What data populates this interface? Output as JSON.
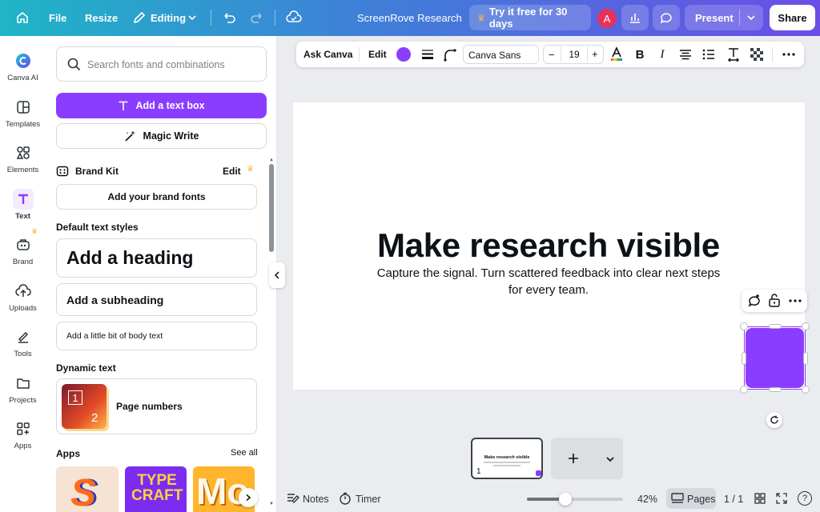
{
  "topbar": {
    "file": "File",
    "resize": "Resize",
    "editing": "Editing",
    "title": "ScreenRove Research",
    "trial": "Try it free for 30 days",
    "avatar_initial": "A",
    "present": "Present",
    "share": "Share"
  },
  "rail": {
    "items": [
      {
        "label": "Canva AI",
        "icon": "canva-ai-icon"
      },
      {
        "label": "Templates",
        "icon": "templates-icon"
      },
      {
        "label": "Elements",
        "icon": "elements-icon"
      },
      {
        "label": "Text",
        "icon": "text-icon"
      },
      {
        "label": "Brand",
        "icon": "brand-icon"
      },
      {
        "label": "Uploads",
        "icon": "uploads-icon"
      },
      {
        "label": "Tools",
        "icon": "tools-icon"
      },
      {
        "label": "Projects",
        "icon": "projects-icon"
      },
      {
        "label": "Apps",
        "icon": "apps-icon"
      }
    ]
  },
  "panel": {
    "search_placeholder": "Search fonts and combinations",
    "add_text_box": "Add a text box",
    "magic_write": "Magic Write",
    "brand_kit": "Brand Kit",
    "brand_kit_edit": "Edit",
    "add_brand_fonts": "Add your brand fonts",
    "default_styles_title": "Default text styles",
    "add_heading": "Add a heading",
    "add_subheading": "Add a subheading",
    "add_body": "Add a little bit of body text",
    "dynamic_text_title": "Dynamic text",
    "page_numbers": "Page numbers",
    "page_numbers_thumb": [
      "1",
      "2"
    ],
    "apps_title": "Apps",
    "see_all": "See all",
    "app_tiles": [
      "S",
      "TYPE CRAFT",
      "Mo"
    ]
  },
  "toolbar": {
    "ask_canva": "Ask Canva",
    "edit": "Edit",
    "font": "Canva Sans",
    "font_size": "19",
    "minus": "−",
    "plus": "+"
  },
  "canvas": {
    "heading": "Make research visible",
    "body": "Capture the signal. Turn scattered feedback into clear next steps for every team.",
    "shape_color": "#8b3dff"
  },
  "bottom": {
    "thumb_title": "Make research visible",
    "thumb_page": "1",
    "notes": "Notes",
    "timer": "Timer",
    "zoom": "42%",
    "pages": "Pages",
    "page_count": "1 / 1",
    "help": "?"
  },
  "colors": {
    "accent": "#8b3dff",
    "topbar_start": "#1fb5c6",
    "topbar_end": "#6a4ee6"
  }
}
